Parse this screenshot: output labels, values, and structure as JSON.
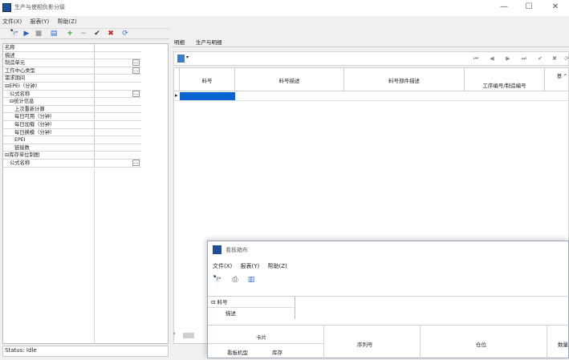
{
  "main_window": {
    "title": "生产与使相负影分级",
    "menu": [
      "文件(X)",
      "报表(Y)",
      "帮助(Z)"
    ],
    "tabs": [
      "明细",
      "生产与明细"
    ],
    "status": "Status: Idle"
  },
  "properties": {
    "rows": [
      {
        "label": "名称",
        "indent": 0,
        "ellipsis": false
      },
      {
        "label": "描述",
        "indent": 0,
        "ellipsis": false
      },
      {
        "label": "制造单元",
        "indent": 0,
        "ellipsis": true
      },
      {
        "label": "工作中心类型",
        "indent": 0,
        "ellipsis": true
      },
      {
        "label": "需求期间",
        "indent": 0,
        "ellipsis": false
      },
      {
        "label": "⊟EPEI（分钟）",
        "indent": 0,
        "ellipsis": false
      },
      {
        "label": "公式名称",
        "indent": 1,
        "ellipsis": true
      },
      {
        "label": "⊟统计信息",
        "indent": 1,
        "ellipsis": false
      },
      {
        "label": "上次重新计算",
        "indent": 2,
        "ellipsis": false
      },
      {
        "label": "每日可用（分钟）",
        "indent": 2,
        "ellipsis": false
      },
      {
        "label": "每日加载（分钟）",
        "indent": 2,
        "ellipsis": false
      },
      {
        "label": "每日换模（分钟）",
        "indent": 2,
        "ellipsis": false
      },
      {
        "label": "EPEI",
        "indent": 2,
        "ellipsis": false
      },
      {
        "label": "链接数",
        "indent": 2,
        "ellipsis": false
      },
      {
        "label": "⊟库存单位制图",
        "indent": 0,
        "ellipsis": false
      },
      {
        "label": "公式名称",
        "indent": 1,
        "ellipsis": true
      }
    ]
  },
  "grid": {
    "columns": [
      "料号",
      "料号描述",
      "料号部件描述",
      "工序编号/制造编号"
    ],
    "extra_header": "基 ^"
  },
  "popup": {
    "title": "看板箱布",
    "menu": [
      "文件(X)",
      "报表(Y)",
      "帮助(Z)"
    ],
    "tree": [
      "⊟ 料号",
      "描述"
    ],
    "grid": {
      "group_header": "卡片",
      "sub_columns": [
        "看板机型",
        "库存"
      ],
      "columns": [
        "序列号",
        "仓位",
        "数量"
      ]
    }
  },
  "colors": {
    "accent": "#0a64d2",
    "green_plus": "#2aa02a",
    "red_x": "#d02020"
  }
}
